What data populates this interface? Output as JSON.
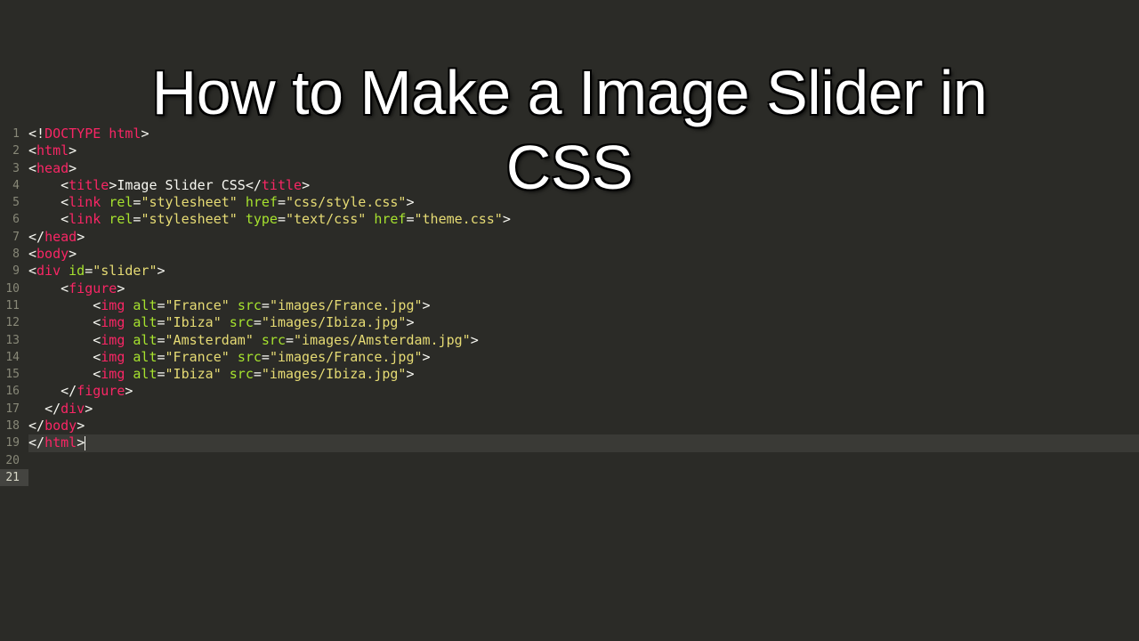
{
  "overlay": {
    "line1": "How to Make a Image Slider in",
    "line2": "CSS"
  },
  "line_numbers": [
    "1",
    "2",
    "3",
    "4",
    "5",
    "6",
    "7",
    "8",
    "9",
    "10",
    "11",
    "12",
    "13",
    "14",
    "15",
    "16",
    "17",
    "18",
    "19",
    "20",
    "21"
  ],
  "active_line": 21,
  "code": {
    "l1": {
      "content": "<!DOCTYPE html>"
    },
    "l2": {
      "content": "<html>"
    },
    "l3": {
      "content": "<head>"
    },
    "l4": {
      "indent": "    ",
      "open": "<title>",
      "text": "Image Slider CSS",
      "close": "</title>"
    },
    "l5": {
      "indent": "    ",
      "tag": "link",
      "attrs": [
        [
          "rel",
          "stylesheet"
        ],
        [
          "href",
          "css/style.css"
        ]
      ]
    },
    "l6": {
      "indent": "    ",
      "tag": "link",
      "attrs": [
        [
          "rel",
          "stylesheet"
        ],
        [
          "type",
          "text/css"
        ],
        [
          "href",
          "theme.css"
        ]
      ]
    },
    "l7": {
      "content": "</head>"
    },
    "l8": {
      "content": "<body>"
    },
    "l10": {
      "tag": "div",
      "attrs": [
        [
          "id",
          "slider"
        ]
      ]
    },
    "l11": {
      "indent": "    ",
      "content": "<figure>"
    },
    "l12": {
      "indent": "        ",
      "tag": "img",
      "attrs": [
        [
          "alt",
          "France"
        ],
        [
          "src",
          "images/France.jpg"
        ]
      ]
    },
    "l13": {
      "indent": "        ",
      "tag": "img",
      "attrs": [
        [
          "alt",
          "Ibiza"
        ],
        [
          "src",
          "images/Ibiza.jpg"
        ]
      ]
    },
    "l14": {
      "indent": "        ",
      "tag": "img",
      "attrs": [
        [
          "alt",
          "Amsterdam"
        ],
        [
          "src",
          "images/Amsterdam.jpg"
        ]
      ]
    },
    "l15": {
      "indent": "        ",
      "tag": "img",
      "attrs": [
        [
          "alt",
          "France"
        ],
        [
          "src",
          "images/France.jpg"
        ]
      ]
    },
    "l16": {
      "indent": "        ",
      "tag": "img",
      "attrs": [
        [
          "alt",
          "Ibiza"
        ],
        [
          "src",
          "images/Ibiza.jpg"
        ]
      ]
    },
    "l17": {
      "indent": "    ",
      "content": "</figure>"
    },
    "l18": {
      "indent": "  ",
      "content": "</div>"
    },
    "l20": {
      "content": "</body>"
    },
    "l21": {
      "content": "</html>"
    }
  }
}
